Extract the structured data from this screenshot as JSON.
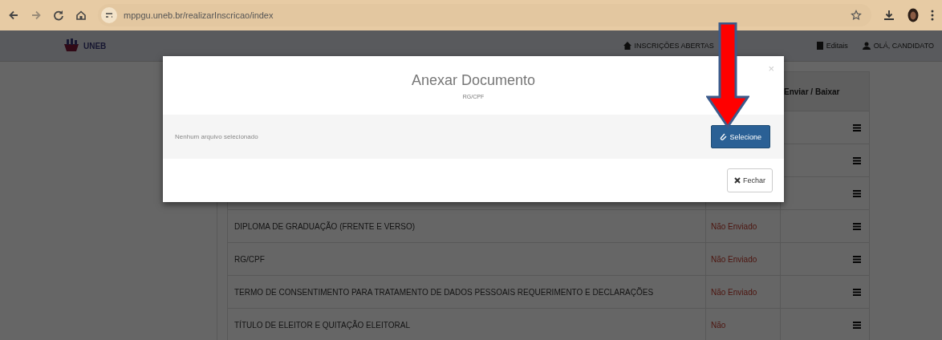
{
  "browser": {
    "url": "mppgu.uneb.br/realizarInscricao/index"
  },
  "navbar": {
    "logo_text": "UNEB",
    "links": [
      {
        "label": "INSCRIÇÕES ABERTAS"
      },
      {
        "label": "Editais"
      },
      {
        "label": "OLÁ, CANDIDATO"
      }
    ]
  },
  "table": {
    "columns": [
      "Enviar / Baixar"
    ],
    "rows": [
      {
        "kind": "covered"
      },
      {
        "kind": "covered"
      },
      {
        "kind": "covered"
      },
      {
        "kind": "document",
        "name": "DIPLOMA DE GRADUAÇÃO (FRENTE E VERSO)",
        "status": "Não Enviado"
      },
      {
        "kind": "document",
        "name": "RG/CPF",
        "status": "Não Enviado"
      },
      {
        "kind": "document",
        "name": "TERMO DE CONSENTIMENTO PARA TRATAMENTO DE DADOS PESSOAIS REQUERIMENTO E DECLARAÇÕES",
        "status": "Não Enviado"
      },
      {
        "kind": "document",
        "name": "TÍTULO DE ELEITOR E QUITAÇÃO ELEITORAL",
        "status": "Não"
      }
    ]
  },
  "dialog": {
    "title": "Anexar Documento",
    "subtitle": "RG/CPF",
    "file_status": "Nenhum arquivo selecionado",
    "select_button": "Selecione",
    "close_button": "Fechar",
    "close_glyph": "×"
  },
  "annotation": {
    "kind": "arrow"
  }
}
